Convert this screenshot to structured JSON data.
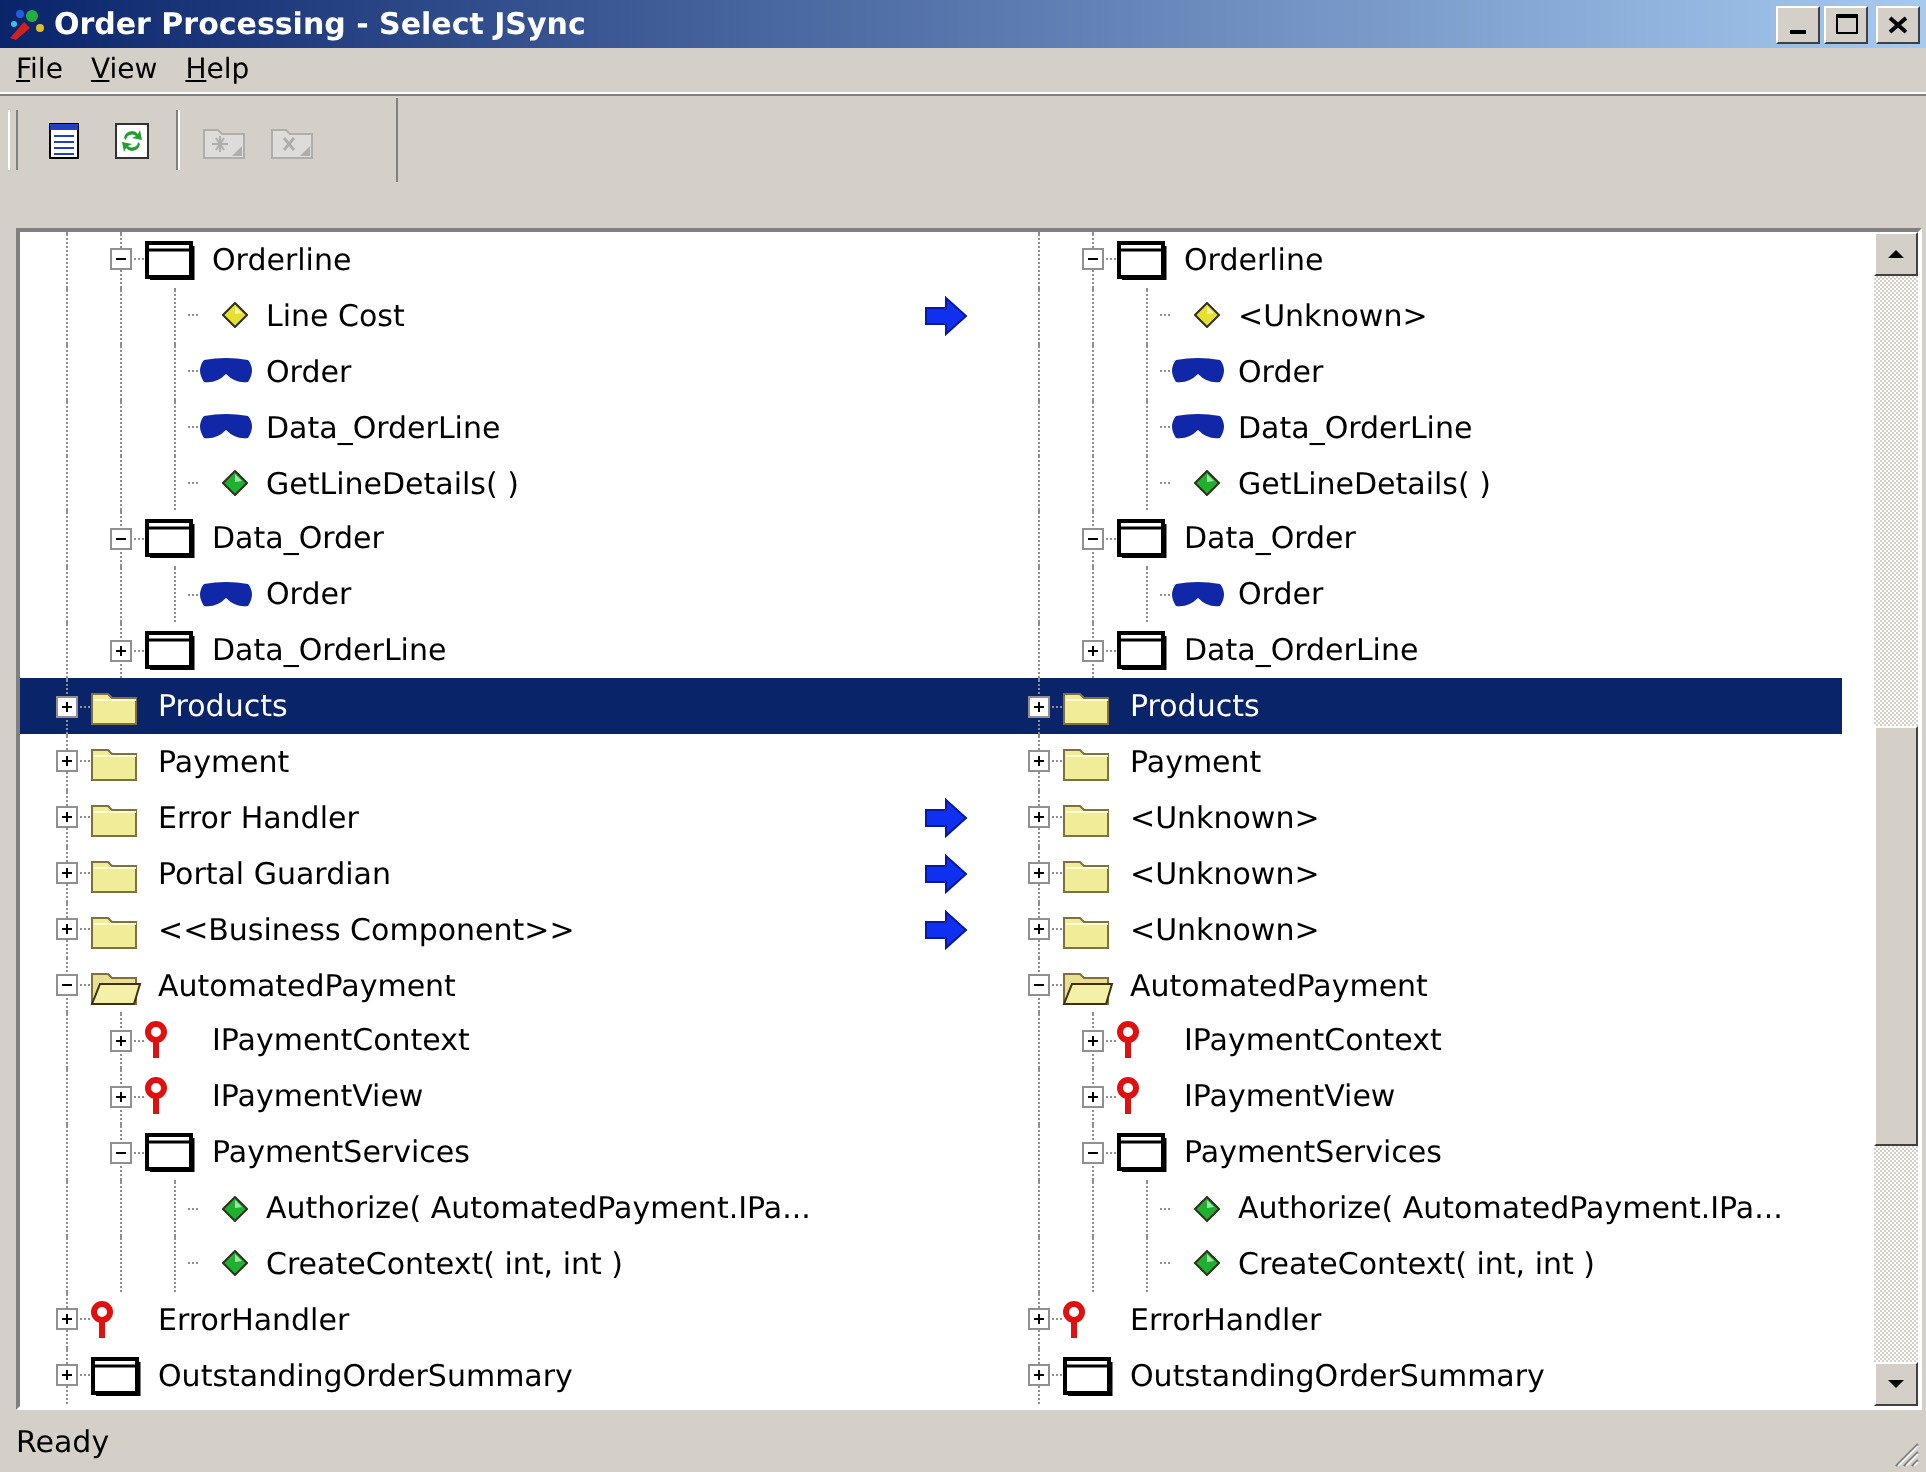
{
  "window": {
    "title": "Order Processing - Select JSync"
  },
  "menu": [
    "File",
    "View",
    "Help"
  ],
  "toolbar": {
    "groups": [
      [
        {
          "kind": "document",
          "disabled": false
        },
        {
          "kind": "refresh",
          "disabled": false
        }
      ],
      [
        {
          "kind": "new_folder",
          "disabled": true
        },
        {
          "kind": "delete_folder",
          "disabled": true
        }
      ]
    ]
  },
  "left_tree": [
    {
      "kind": "group",
      "children": [
        {
          "label": "Orderline",
          "kind": "class",
          "expanded": true,
          "selected": false,
          "arrow": false,
          "children": [
            {
              "label": "Line Cost",
              "kind": "attribute",
              "selected": false,
              "arrow": true
            },
            {
              "label": "Order",
              "kind": "association",
              "selected": false,
              "arrow": false
            },
            {
              "label": "Data_OrderLine",
              "kind": "association",
              "selected": false,
              "arrow": false
            },
            {
              "label": "GetLineDetails( )",
              "kind": "method",
              "selected": false,
              "arrow": false
            }
          ]
        },
        {
          "label": "Data_Order",
          "kind": "class",
          "expanded": true,
          "selected": false,
          "arrow": false,
          "children": [
            {
              "label": "Order",
              "kind": "association",
              "selected": false,
              "arrow": false
            }
          ]
        },
        {
          "label": "Data_OrderLine",
          "kind": "class",
          "expanded": false,
          "selected": false,
          "arrow": false
        }
      ]
    },
    {
      "label": "Products",
      "kind": "folder",
      "expanded": false,
      "selected": true,
      "arrow": false
    },
    {
      "label": "Payment",
      "kind": "folder",
      "expanded": false,
      "selected": false,
      "arrow": false
    },
    {
      "label": "Error Handler",
      "kind": "folder",
      "expanded": false,
      "selected": false,
      "arrow": true
    },
    {
      "label": "Portal Guardian",
      "kind": "folder",
      "expanded": false,
      "selected": false,
      "arrow": true
    },
    {
      "label": "<<Business Component>>",
      "kind": "folder",
      "expanded": false,
      "selected": false,
      "arrow": true
    },
    {
      "label": "AutomatedPayment",
      "kind": "open_folder",
      "expanded": true,
      "selected": false,
      "arrow": false,
      "children": [
        {
          "label": "IPaymentContext",
          "kind": "interface",
          "expanded": false,
          "selected": false,
          "arrow": false
        },
        {
          "label": "IPaymentView",
          "kind": "interface",
          "expanded": false,
          "selected": false,
          "arrow": false
        },
        {
          "label": "PaymentServices",
          "kind": "class",
          "expanded": true,
          "selected": false,
          "arrow": false,
          "children": [
            {
              "label": "Authorize( AutomatedPayment.IPa...",
              "kind": "method",
              "selected": false,
              "arrow": false
            },
            {
              "label": "CreateContext( int, int )",
              "kind": "method",
              "selected": false,
              "arrow": false
            }
          ]
        }
      ]
    },
    {
      "label": "ErrorHandler",
      "kind": "interface",
      "expanded": false,
      "selected": false,
      "arrow": false
    },
    {
      "label": "OutstandingOrderSummary",
      "kind": "class",
      "expanded": false,
      "selected": false,
      "arrow": false
    }
  ],
  "right_tree": [
    {
      "kind": "group",
      "children": [
        {
          "label": "Orderline",
          "kind": "class",
          "expanded": true,
          "selected": false,
          "children": [
            {
              "label": "<Unknown>",
              "kind": "attribute",
              "selected": false
            },
            {
              "label": "Order",
              "kind": "association",
              "selected": false
            },
            {
              "label": "Data_OrderLine",
              "kind": "association",
              "selected": false
            },
            {
              "label": "GetLineDetails( )",
              "kind": "method",
              "selected": false
            }
          ]
        },
        {
          "label": "Data_Order",
          "kind": "class",
          "expanded": true,
          "selected": false,
          "children": [
            {
              "label": "Order",
              "kind": "association",
              "selected": false
            }
          ]
        },
        {
          "label": "Data_OrderLine",
          "kind": "class",
          "expanded": false,
          "selected": false
        }
      ]
    },
    {
      "label": "Products",
      "kind": "folder",
      "expanded": false,
      "selected": true
    },
    {
      "label": "Payment",
      "kind": "folder",
      "expanded": false,
      "selected": false
    },
    {
      "label": "<Unknown>",
      "kind": "folder",
      "expanded": false,
      "selected": false
    },
    {
      "label": "<Unknown>",
      "kind": "folder",
      "expanded": false,
      "selected": false
    },
    {
      "label": "<Unknown>",
      "kind": "folder",
      "expanded": false,
      "selected": false
    },
    {
      "label": "AutomatedPayment",
      "kind": "open_folder",
      "expanded": true,
      "selected": false,
      "children": [
        {
          "label": "IPaymentContext",
          "kind": "interface",
          "expanded": false,
          "selected": false
        },
        {
          "label": "IPaymentView",
          "kind": "interface",
          "expanded": false,
          "selected": false
        },
        {
          "label": "PaymentServices",
          "kind": "class",
          "expanded": true,
          "selected": false,
          "children": [
            {
              "label": "Authorize( AutomatedPayment.IPa...",
              "kind": "method",
              "selected": false
            },
            {
              "label": "CreateContext( int, int )",
              "kind": "method",
              "selected": false
            }
          ]
        }
      ]
    },
    {
      "label": "ErrorHandler",
      "kind": "interface",
      "expanded": false,
      "selected": false
    },
    {
      "label": "OutstandingOrderSummary",
      "kind": "class",
      "expanded": false,
      "selected": false
    }
  ],
  "status_bar": "Ready"
}
